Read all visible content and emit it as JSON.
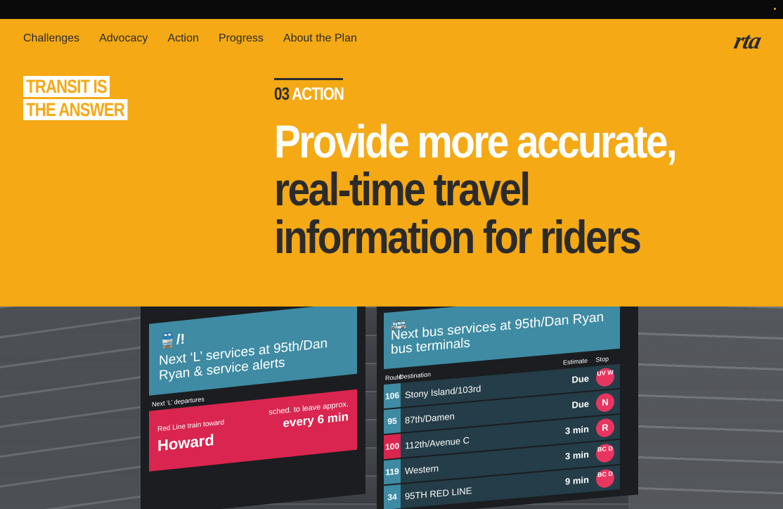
{
  "nav": {
    "items": [
      {
        "label": "Challenges"
      },
      {
        "label": "Advocacy"
      },
      {
        "label": "Action"
      },
      {
        "label": "Progress"
      },
      {
        "label": "About the Plan"
      }
    ],
    "logo": "rta"
  },
  "badge": {
    "line1": "TRANSIT IS",
    "line2": "THE ANSWER"
  },
  "section": {
    "number": "03",
    "label": "ACTION"
  },
  "headline": {
    "line1": "Provide more accurate,",
    "line2": "real-time travel",
    "line3": "information for riders"
  },
  "photo": {
    "left_screen": {
      "icon": "train-alert-icon",
      "title": "Next ‘L’ services at 95th/Dan Ryan & service alerts",
      "sub": "Next ‘L’ departures",
      "line_label": "Red Line train toward",
      "destination": "Howard",
      "sched_label": "sched. to leave approx.",
      "frequency": "every 6 min"
    },
    "right_screen": {
      "icon": "bus-icon",
      "title": "Next bus services at 95th/Dan Ryan bus terminals",
      "col_route": "Route",
      "col_dest": "Destination",
      "col_est": "Estimate",
      "col_stop": "Stop",
      "rows": [
        {
          "route": "106",
          "dest": "Stony Island/103rd",
          "est": "Due",
          "stop": "UV W"
        },
        {
          "route": "95",
          "dest": "87th/Damen",
          "est": "Due",
          "stop": "N"
        },
        {
          "route": "100",
          "dest": "112th/Avenue C",
          "est": "3 min",
          "stop": "R"
        },
        {
          "route": "119",
          "dest": "Western",
          "est": "3 min",
          "stop": "BC D"
        },
        {
          "route": "34",
          "dest": "95TH RED LINE",
          "est": "9 min",
          "stop": "BC D"
        }
      ]
    }
  },
  "colors": {
    "brand": "#f4a915",
    "dark": "#2b2b2b",
    "screen_blue": "#3e8ba3",
    "alert_red": "#d9254f"
  }
}
